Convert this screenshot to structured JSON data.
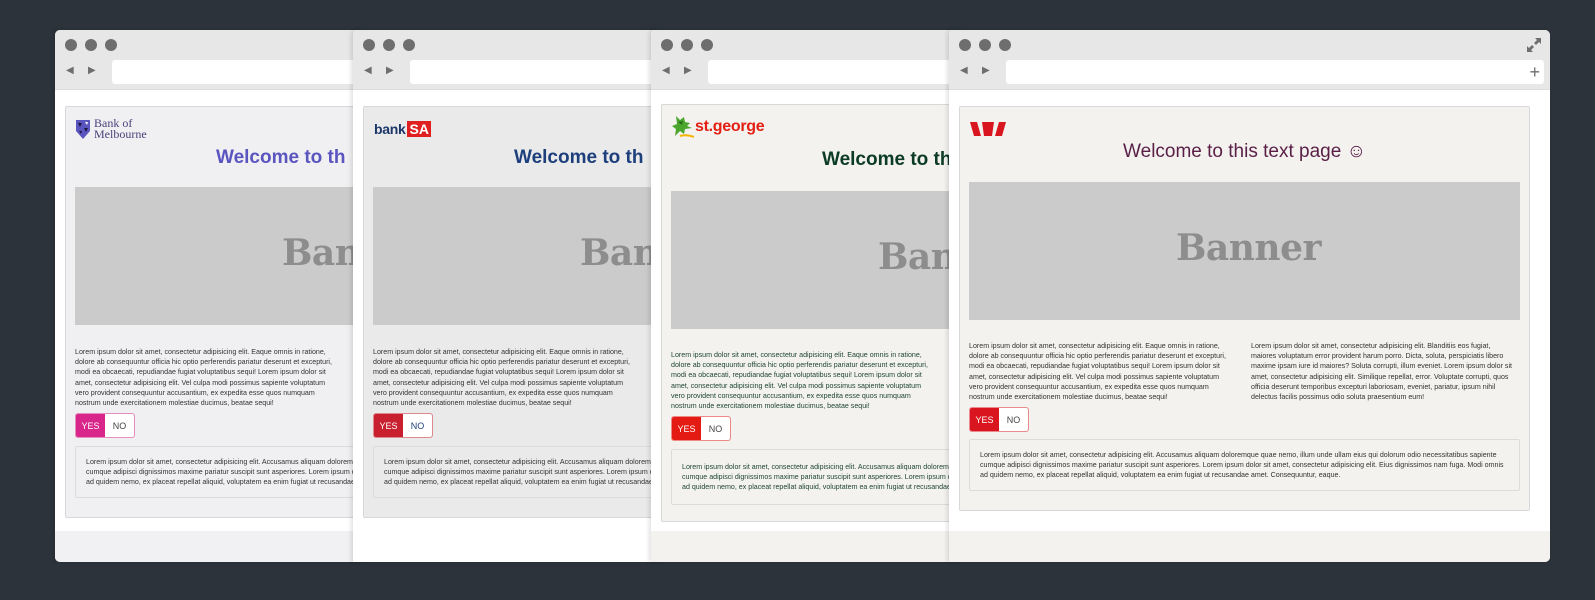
{
  "browser": {
    "nav_back_icon": "◀",
    "nav_forward_icon": "▶",
    "new_tab_icon": "+",
    "expand_icon": "expand-arrows"
  },
  "common": {
    "welcome_full": "Welcome to this text page ☺",
    "welcome_truncated": "Welcome to th",
    "banner_label": "Banner",
    "yes_label": "YES",
    "no_label": "NO",
    "paragraph_1": "Lorem ipsum dolor sit amet, consectetur adipisicing elit. Eaque omnis in ratione, dolore ab consequuntur officia hic optio perferendis pariatur deserunt et excepturi, modi ea obcaecati, repudiandae fugiat voluptatibus sequi! Lorem ipsum dolor sit amet, consectetur adipisicing elit. Vel culpa modi possimus sapiente voluptatum vero provident consequuntur accusantium, ex expedita esse quos numquam nostrum unde exercitationem molestiae ducimus, beatae sequi!",
    "paragraph_2": "Lorem ipsum dolor sit amet, consectetur adipisicing elit. Blanditiis eos fugiat, maiores voluptatum error provident harum porro. Dicta, soluta, perspiciatis libero maxime ipsam iure id maiores? Soluta corrupti, illum eveniet. Lorem ipsum dolor sit amet, consectetur adipisicing elit. Similique repellat, error. Voluptate corrupti, quos officia deserunt temporibus excepturi laboriosam, eveniet, pariatur, ipsum nihil delectus facilis possimus odio soluta praesentium eum!",
    "well_text": "Lorem ipsum dolor sit amet, consectetur adipisicing elit. Accusamus aliquam doloremque quae nemo, illum unde ullam eius qui dolorum odio necessitatibus sapiente cumque adipisci dignissimos maxime pariatur suscipit sunt asperiores. Lorem ipsum dolor sit amet, consectetur adipisicing elit. Eius dignissimos nam fuga. Modi omnis ad quidem nemo, ex placeat repellat aliquid, voluptatem ea enim fugiat ut recusandae amet. Consequuntur, eaque."
  },
  "windows": [
    {
      "brand": "Bank of Melbourne",
      "logo_line1": "Bank of",
      "logo_line2": "Melbourne",
      "heading_color": "#5b55c0",
      "toggle_color": "#d9268a",
      "toggle_border": "#e68fbf"
    },
    {
      "brand": "BankSA",
      "logo_text": "bank",
      "logo_box": "SA",
      "heading_color": "#1d3f7c",
      "toggle_color": "#c8202f",
      "toggle_border": "#e08890"
    },
    {
      "brand": "St.George",
      "logo_text": "st.george",
      "heading_color": "#0c3b26",
      "toggle_color": "#e41b13",
      "toggle_border": "#ee8a85"
    },
    {
      "brand": "Westpac",
      "heading_color": "#5a1f46",
      "toggle_color": "#d9161f",
      "toggle_border": "#eb8a8e"
    }
  ]
}
